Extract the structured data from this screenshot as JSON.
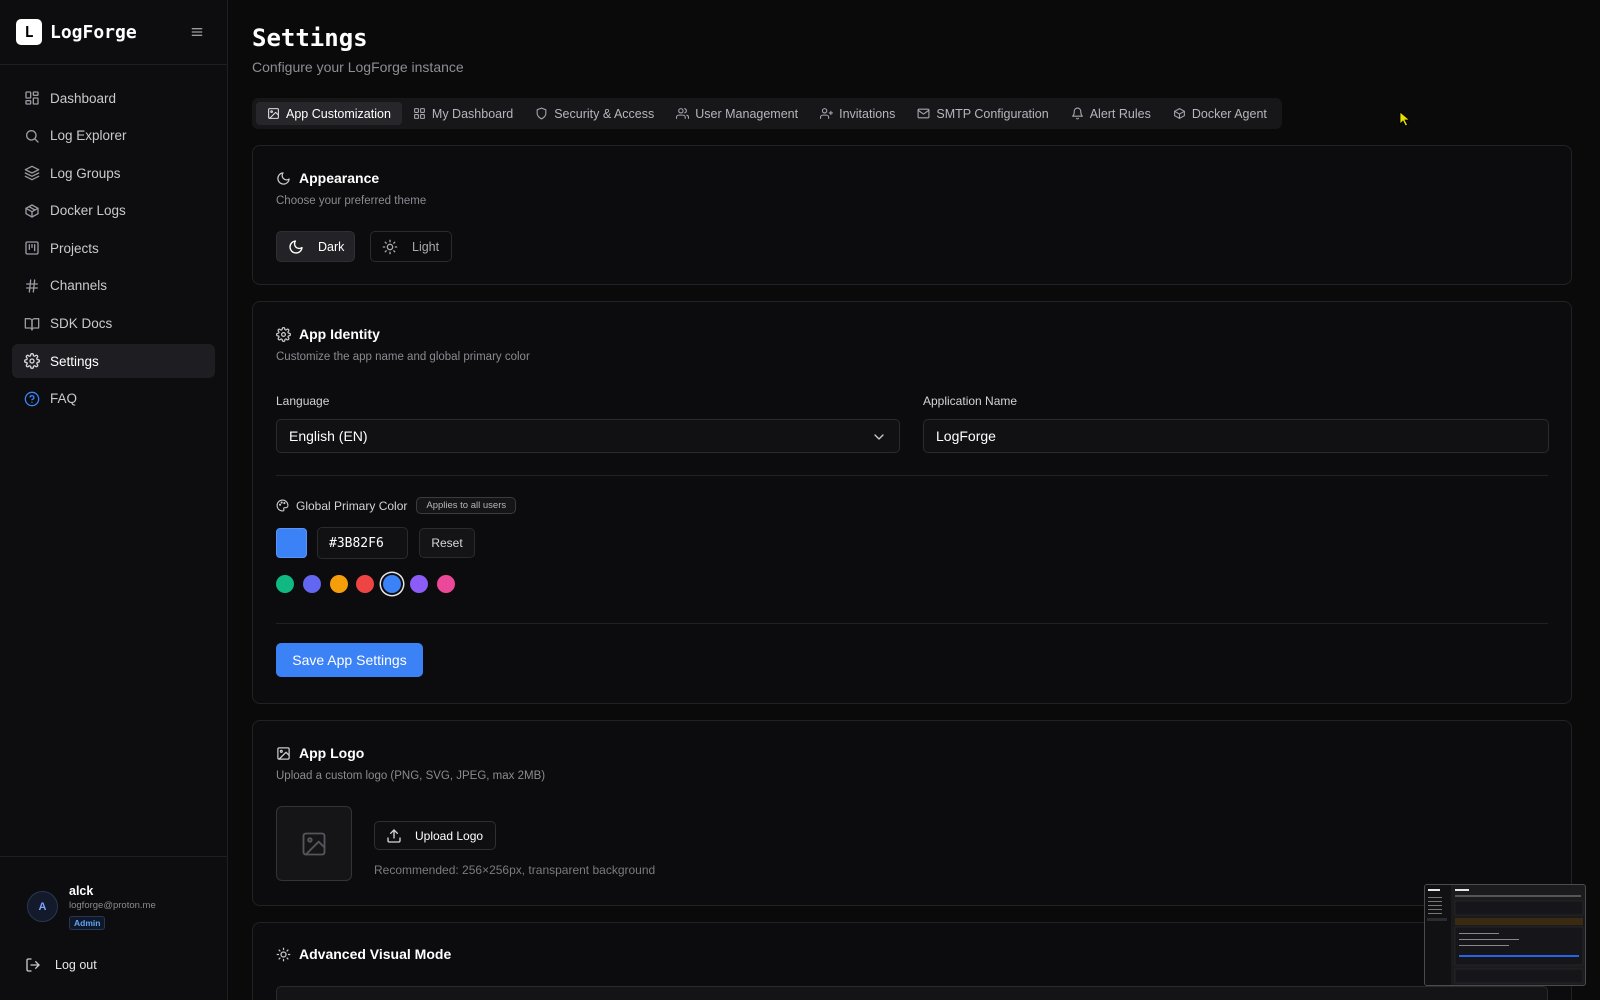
{
  "app": {
    "logo_letter": "L",
    "name": "LogForge"
  },
  "sidebar": {
    "items": [
      {
        "label": "Dashboard",
        "icon": "layout-grid-icon"
      },
      {
        "label": "Log Explorer",
        "icon": "search-icon"
      },
      {
        "label": "Log Groups",
        "icon": "layers-icon"
      },
      {
        "label": "Docker Logs",
        "icon": "package-icon"
      },
      {
        "label": "Projects",
        "icon": "kanban-icon"
      },
      {
        "label": "Channels",
        "icon": "hash-icon"
      },
      {
        "label": "SDK Docs",
        "icon": "book-open-icon"
      },
      {
        "label": "Settings",
        "icon": "gear-icon",
        "active": true
      },
      {
        "label": "FAQ",
        "icon": "help-circle-icon"
      }
    ],
    "user": {
      "avatar_initial": "A",
      "name": "alck",
      "email": "logforge@proton.me",
      "role": "Admin"
    },
    "logout_label": "Log out"
  },
  "page": {
    "title": "Settings",
    "subtitle": "Configure your LogForge instance"
  },
  "tabs": [
    {
      "label": "App Customization",
      "icon": "image-icon",
      "active": true
    },
    {
      "label": "My Dashboard",
      "icon": "layout-grid-icon"
    },
    {
      "label": "Security & Access",
      "icon": "shield-icon"
    },
    {
      "label": "User Management",
      "icon": "users-icon"
    },
    {
      "label": "Invitations",
      "icon": "user-plus-icon"
    },
    {
      "label": "SMTP Configuration",
      "icon": "mail-icon"
    },
    {
      "label": "Alert Rules",
      "icon": "bell-icon"
    },
    {
      "label": "Docker Agent",
      "icon": "package-icon"
    }
  ],
  "appearance": {
    "title": "Appearance",
    "description": "Choose your preferred theme",
    "dark_label": "Dark",
    "light_label": "Light",
    "selected": "Dark"
  },
  "identity": {
    "title": "App Identity",
    "description": "Customize the app name and global primary color",
    "language_label": "Language",
    "language_value": "English (EN)",
    "app_name_label": "Application Name",
    "app_name_value": "LogForge",
    "primary_color_label": "Global Primary Color",
    "primary_color_badge": "Applies to all users",
    "primary_color_value": "#3B82F6",
    "reset_label": "Reset",
    "presets": [
      "#10b981",
      "#6366f1",
      "#f59e0b",
      "#ef4444",
      "#3b82f6",
      "#8b5cf6",
      "#ec4899"
    ],
    "selected_preset_index": 4,
    "save_label": "Save App Settings"
  },
  "logo": {
    "title": "App Logo",
    "description": "Upload a custom logo (PNG, SVG, JPEG, max 2MB)",
    "upload_label": "Upload Logo",
    "hint": "Recommended: 256×256px, transparent background"
  },
  "advanced": {
    "title": "Advanced Visual Mode"
  },
  "colors": {
    "accent": "#3b82f6",
    "background": "#0a0a0b",
    "cursor": "#e8e000"
  }
}
